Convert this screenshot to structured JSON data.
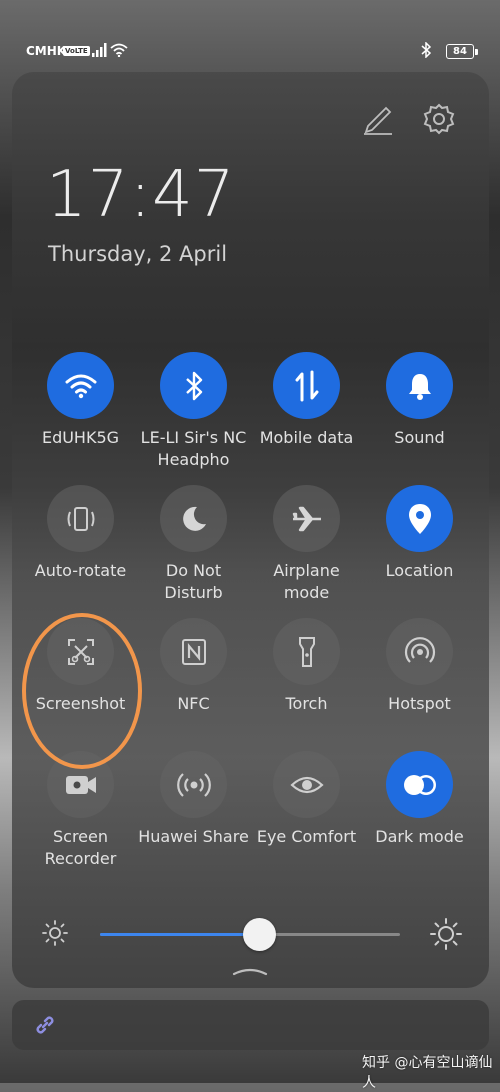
{
  "status_bar": {
    "carrier": "CMHK",
    "volte": "VoLTE",
    "battery": "84"
  },
  "header": {
    "time": "17:47",
    "date": "Thursday, 2 April"
  },
  "tiles": [
    {
      "label": "EdUHK5G",
      "icon": "wifi-icon",
      "on": true
    },
    {
      "label": "LE-LI Sir's NC Headpho",
      "icon": "bluetooth-icon",
      "on": true
    },
    {
      "label": "Mobile data",
      "icon": "mobile-data-icon",
      "on": true
    },
    {
      "label": "Sound",
      "icon": "bell-icon",
      "on": true
    },
    {
      "label": "Auto-rotate",
      "icon": "auto-rotate-icon",
      "on": false
    },
    {
      "label": "Do Not Disturb",
      "icon": "moon-icon",
      "on": false
    },
    {
      "label": "Airplane mode",
      "icon": "airplane-icon",
      "on": false
    },
    {
      "label": "Location",
      "icon": "location-pin-icon",
      "on": true
    },
    {
      "label": "Screenshot",
      "icon": "screenshot-icon",
      "on": false
    },
    {
      "label": "NFC",
      "icon": "nfc-icon",
      "on": false
    },
    {
      "label": "Torch",
      "icon": "torch-icon",
      "on": false
    },
    {
      "label": "Hotspot",
      "icon": "hotspot-icon",
      "on": false
    },
    {
      "label": "Screen Recorder",
      "icon": "screen-recorder-icon",
      "on": false
    },
    {
      "label": "Huawei Share",
      "icon": "huawei-share-icon",
      "on": false
    },
    {
      "label": "Eye Comfort",
      "icon": "eye-icon",
      "on": false
    },
    {
      "label": "Dark mode",
      "icon": "dark-mode-icon",
      "on": true
    }
  ],
  "brightness": {
    "level": 0.53
  },
  "watermark": "知乎 @心有空山谪仙人",
  "colors": {
    "accent": "#1f6ce0",
    "highlight": "#f2964b",
    "slider_fill": "#3d86ef"
  }
}
